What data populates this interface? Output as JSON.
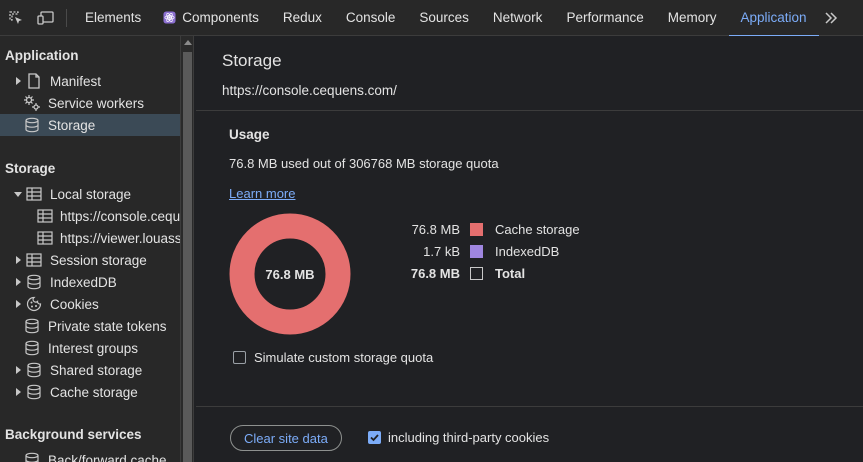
{
  "tabs": [
    {
      "label": "Elements"
    },
    {
      "label": "Components"
    },
    {
      "label": "Redux"
    },
    {
      "label": "Console"
    },
    {
      "label": "Sources"
    },
    {
      "label": "Network"
    },
    {
      "label": "Performance"
    },
    {
      "label": "Memory"
    },
    {
      "label": "Application"
    }
  ],
  "active_tab": "Application",
  "sidebar": {
    "application_title": "Application",
    "application_items": [
      {
        "label": "Manifest"
      },
      {
        "label": "Service workers"
      },
      {
        "label": "Storage"
      }
    ],
    "storage_title": "Storage",
    "storage_items": [
      {
        "label": "Local storage"
      },
      {
        "label": "https://console.cequ"
      },
      {
        "label": "https://viewer.louass"
      },
      {
        "label": "Session storage"
      },
      {
        "label": "IndexedDB"
      },
      {
        "label": "Cookies"
      },
      {
        "label": "Private state tokens"
      },
      {
        "label": "Interest groups"
      },
      {
        "label": "Shared storage"
      },
      {
        "label": "Cache storage"
      }
    ],
    "background_title": "Background services",
    "background_items": [
      {
        "label": "Back/forward cache"
      }
    ]
  },
  "main": {
    "title": "Storage",
    "origin": "https://console.cequens.com/",
    "usage_heading": "Usage",
    "usage_text": "76.8 MB used out of 306768 MB storage quota",
    "learn_more": "Learn more",
    "donut_label": "76.8 MB",
    "legend": [
      {
        "value": "76.8 MB",
        "label": "Cache storage",
        "color": "#e46f6f"
      },
      {
        "value": "1.7 kB",
        "label": "IndexedDB",
        "color": "#9f86e0"
      },
      {
        "value": "76.8 MB",
        "label": "Total",
        "color": ""
      }
    ],
    "simulate_label": "Simulate custom storage quota",
    "simulate_checked": false,
    "clear_button": "Clear site data",
    "third_party_label": "including third-party cookies",
    "third_party_checked": true
  },
  "colors": {
    "accent": "#7cacf8",
    "donut": "#e46f6f",
    "selected_row": "#3b4a56"
  }
}
